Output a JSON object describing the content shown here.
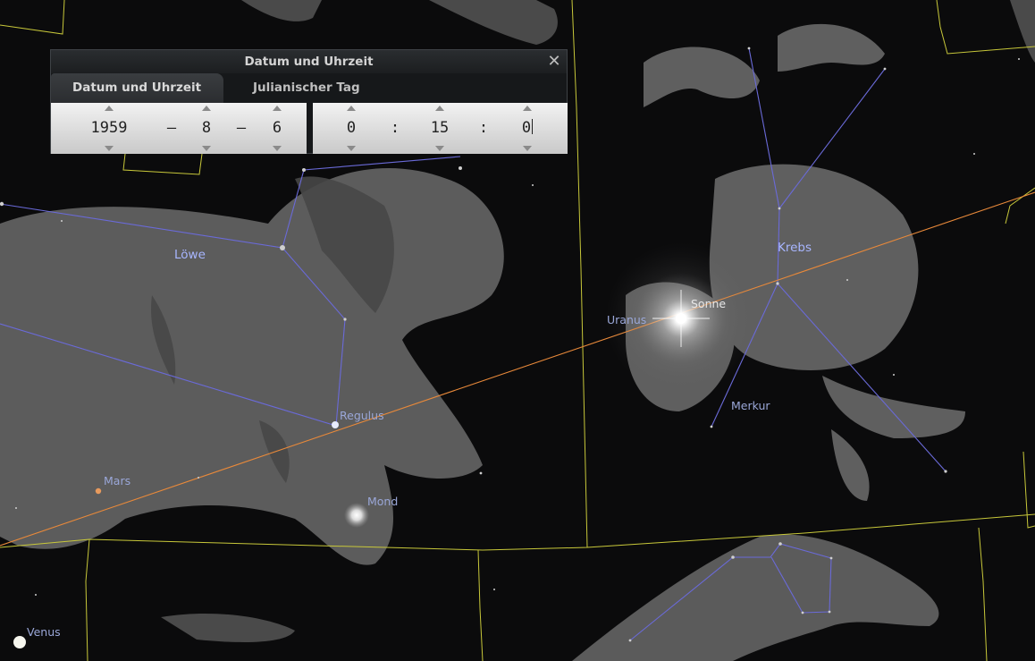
{
  "dialog": {
    "title": "Datum und Uhrzeit",
    "close_icon": "close-icon",
    "tabs": [
      {
        "label": "Datum und Uhrzeit",
        "active": true
      },
      {
        "label": "Julianischer Tag",
        "active": false
      }
    ],
    "date": {
      "year": "1959",
      "month": "8",
      "day": "6",
      "separator": "–"
    },
    "time": {
      "hour": "0",
      "minute": "15",
      "second": "0",
      "separator": ":"
    }
  },
  "sky": {
    "objects": {
      "sun": "Sonne",
      "uranus": "Uranus",
      "mercury": "Merkur",
      "regulus": "Regulus",
      "mars": "Mars",
      "moon": "Mond",
      "venus": "Venus"
    },
    "constellations": {
      "leo": "Löwe",
      "cancer": "Krebs"
    },
    "colors": {
      "ecliptic": "#e8893a",
      "boundaries": "#c8c83a",
      "lines": "#6a6ad8",
      "label": "#9aa7d8"
    }
  }
}
